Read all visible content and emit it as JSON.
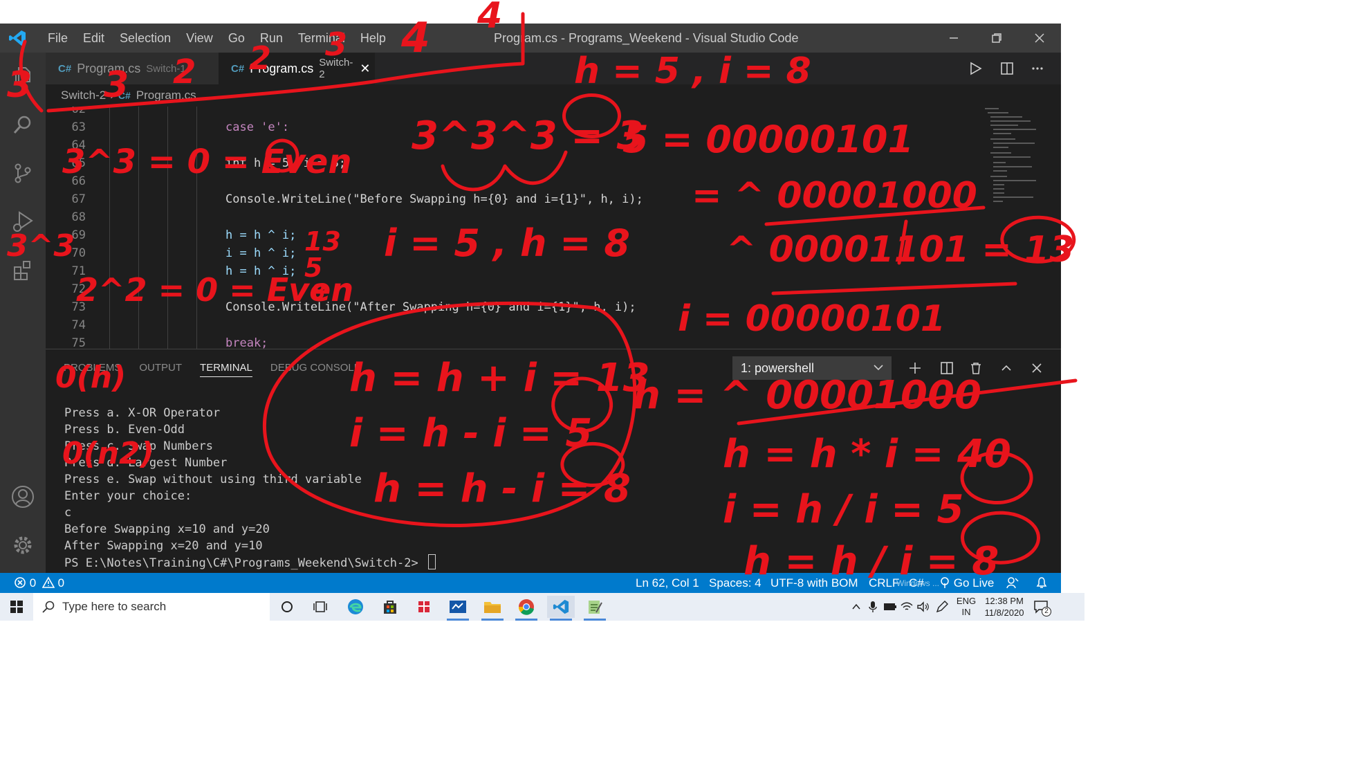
{
  "window": {
    "title": "Program.cs - Programs_Weekend - Visual Studio Code",
    "menu": [
      "File",
      "Edit",
      "Selection",
      "View",
      "Go",
      "Run",
      "Terminal",
      "Help"
    ]
  },
  "activity_bar": [
    "explorer-icon",
    "search-icon",
    "source-control-icon",
    "run-debug-icon",
    "extensions-icon",
    "account-icon",
    "settings-gear-icon"
  ],
  "tabs": [
    {
      "icon": "C#",
      "label": "Program.cs",
      "description": "Switch-1",
      "active": false
    },
    {
      "icon": "C#",
      "label": "Program.cs",
      "description": "Switch-2",
      "active": true,
      "close": "✕"
    }
  ],
  "editor_actions": [
    "run-icon",
    "split-editor-icon",
    "more-actions-icon"
  ],
  "breadcrumb": {
    "folder": "Switch-2",
    "separator": "›",
    "icon": "C#",
    "file": "Program.cs"
  },
  "editor": {
    "lines": [
      {
        "num": "62",
        "code": ""
      },
      {
        "num": "63",
        "code": "case 'e':"
      },
      {
        "num": "64",
        "code": ""
      },
      {
        "num": "65",
        "code": "int h = 5, i = 8;"
      },
      {
        "num": "66",
        "code": ""
      },
      {
        "num": "67",
        "code": "Console.WriteLine(\"Before Swapping h={0} and i={1}\", h, i);"
      },
      {
        "num": "68",
        "code": ""
      },
      {
        "num": "69",
        "code": "h = h ^ i;"
      },
      {
        "num": "70",
        "code": "i = h ^ i;"
      },
      {
        "num": "71",
        "code": "h = h ^ i;"
      },
      {
        "num": "72",
        "code": ""
      },
      {
        "num": "73",
        "code": "Console.WriteLine(\"After Swapping h={0} and i={1}\", h, i);"
      },
      {
        "num": "74",
        "code": ""
      },
      {
        "num": "75",
        "code": "break;"
      }
    ]
  },
  "panel": {
    "tabs": [
      "PROBLEMS",
      "OUTPUT",
      "TERMINAL",
      "DEBUG CONSOLE"
    ],
    "active_tab": "TERMINAL",
    "terminal_select": "1: powershell",
    "actions": [
      "new-terminal-icon",
      "split-terminal-icon",
      "trash-icon",
      "maximize-panel-icon",
      "close-panel-icon"
    ],
    "terminal_lines": [
      "Press a. X-OR Operator",
      "Press b. Even-Odd",
      "Press c. Swap Numbers",
      "Press d. Largest Number",
      "Press e. Swap without using third variable",
      "Enter your choice:",
      "c",
      "Before Swapping x=10 and y=20",
      "After Swapping x=20 and y=10",
      "PS E:\\Notes\\Training\\C#\\Programs_Weekend\\Switch-2> "
    ]
  },
  "status_bar": {
    "errors": "0",
    "warnings": "0",
    "position": "Ln 62, Col 1",
    "spaces": "Spaces: 4",
    "encoding": "UTF-8 with BOM",
    "eol": "CRLF",
    "language": "C#",
    "go_live": "Go Live",
    "watermark": "Windows ..."
  },
  "taskbar": {
    "search_placeholder": "Type here to search",
    "lang_top": "ENG",
    "lang_bottom": "IN",
    "time": "12:38 PM",
    "date": "11/8/2020",
    "notifications": "2"
  },
  "annotations": {
    "ink_color": "#e8141c",
    "top": [
      "3",
      "3",
      "2",
      "2",
      "3",
      "4",
      "4"
    ],
    "left_1": "3^3 = 0 = Even",
    "left_2": "3^3",
    "left_3": "2^2 = 0 = Even",
    "odd": "0(h)",
    "even": "0(n2)",
    "values": "h = 5 , i = 8",
    "xor_demo": "3^3^3 = 3",
    "swap_result": "i = 5 , h = 8",
    "after_69": "13",
    "after_70": "5",
    "after_71": "8",
    "binary": [
      "5 = 00000101",
      "= ^ 00001000",
      "^ 00001101 = 13",
      "i = 00000101",
      "h = ^ 00001000"
    ],
    "add_method": [
      "h = h + i = 13",
      "i = h - i = 5",
      "h = h - i = 8"
    ],
    "mul_method": [
      "h = h * i = 40",
      "i = h / i = 5",
      "h = h / i = 8"
    ]
  }
}
